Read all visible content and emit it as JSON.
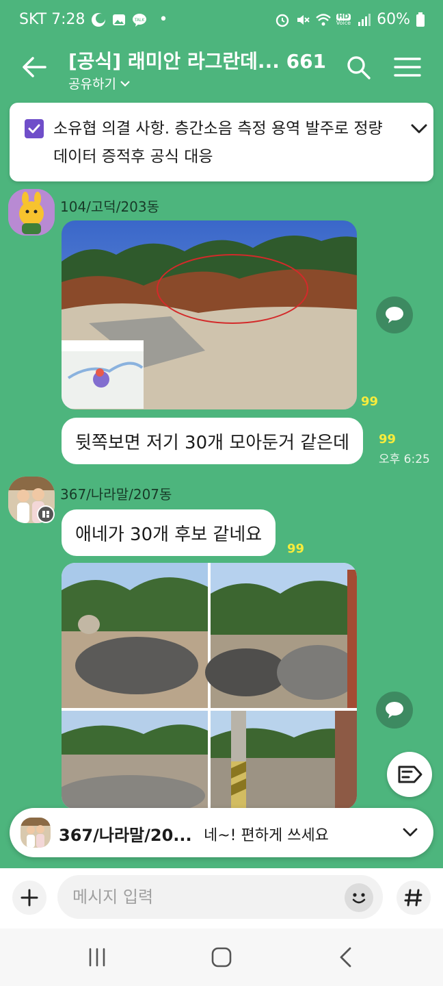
{
  "status_bar": {
    "carrier_time": "SKT 7:28",
    "dot": "•",
    "battery": "60%",
    "hd_badge": "HD",
    "voice_badge": "Voice",
    "talk_badge": "TALK"
  },
  "header": {
    "title": "[공식] 래미안 라그란데... 661",
    "share_label": "공유하기"
  },
  "notice": {
    "text": "소유협 의결 사항. 층간소음 측정 용역 발주로 정량 데이터 증적후 공식 대응"
  },
  "messages": [
    {
      "sender": "104/고덕/203동",
      "photo_unread": "99",
      "text": "뒷쪽보면 저기 30개 모아둔거 같은데",
      "text_unread": "99",
      "time": "오후 6:25"
    },
    {
      "sender": "367/나라말/207동",
      "text": "애네가 30개 후보 같네요",
      "text_unread": "99"
    }
  ],
  "latest_preview": {
    "sender": "367/나라말/20...",
    "text": "네~! 편하게 쓰세요"
  },
  "input": {
    "placeholder": "메시지 입력"
  },
  "icons": {
    "back": "arrow-left-icon",
    "search": "search-icon",
    "menu": "hamburger-icon",
    "notice": "checkbox-icon",
    "share": "speech-bubble-icon",
    "tag": "tag-icon",
    "plus": "plus-icon",
    "emoji": "smiley-icon",
    "hash": "hash-icon"
  },
  "colors": {
    "background": "#4db57d",
    "unread": "#f7ec3c",
    "notice_check": "#6f4ec9"
  }
}
